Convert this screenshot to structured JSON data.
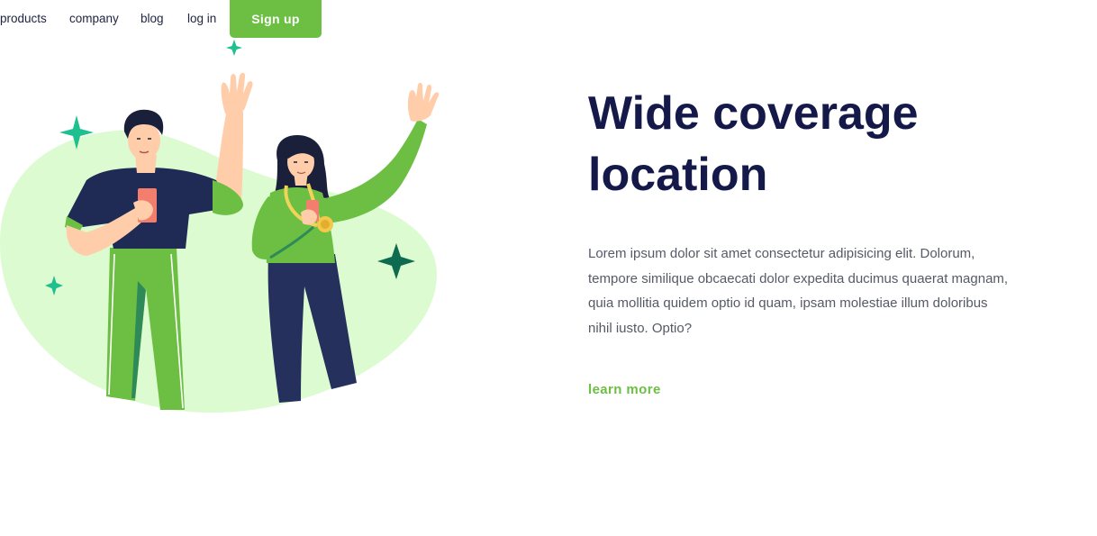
{
  "nav": {
    "links": [
      {
        "label": "products"
      },
      {
        "label": "company"
      },
      {
        "label": "blog"
      },
      {
        "label": "log in"
      }
    ],
    "signup_label": "Sign up"
  },
  "hero": {
    "headline_line1": "Wide coverage",
    "headline_line2": "location",
    "body": "Lorem ipsum dolor sit amet consectetur adipisicing elit. Dolorum, tempore similique obcaecati dolor expedita ducimus quaerat magnam, quia mollitia quidem optio id quam, ipsam molestiae illum doloribus nihil iusto. Optio?",
    "cta_label": "learn more"
  },
  "colors": {
    "brand_green": "#6cbf43",
    "headline_navy": "#14194a",
    "blob_mint": "#dcfbd0",
    "sparkle_teal": "#1fbf8f",
    "sparkle_dark": "#0f6b4f"
  },
  "icons": [
    "sparkle-icon"
  ]
}
